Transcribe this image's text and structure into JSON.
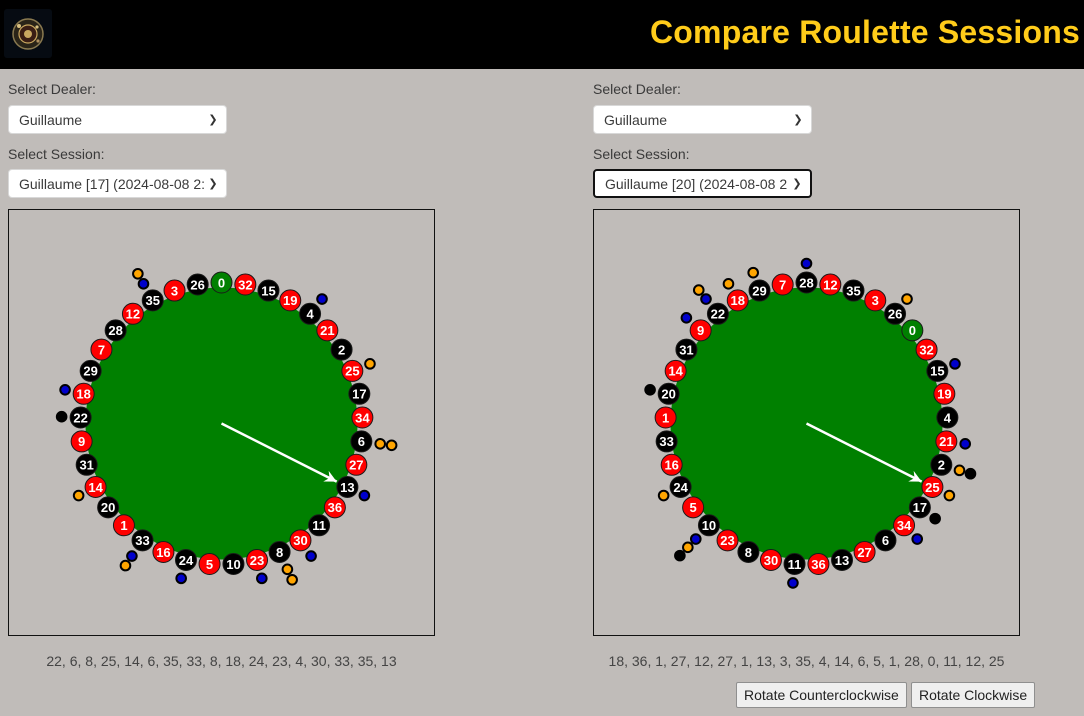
{
  "header": {
    "title": "Compare Roulette Sessions",
    "logo_icon": "roulette-wheel-logo"
  },
  "colors": {
    "header_bg": "#000000",
    "title": "#ffcc1a",
    "page_bg": "#c0bcb9",
    "felt": "#008000",
    "red": "#ff0000",
    "black": "#000000",
    "zero": "#008000",
    "dot_orange": "#ffa500",
    "dot_blue": "#0000cc",
    "dot_black": "#000000",
    "arrow": "#ffffff"
  },
  "wheel_order": [
    0,
    32,
    15,
    19,
    4,
    21,
    2,
    25,
    17,
    34,
    6,
    27,
    13,
    36,
    11,
    30,
    8,
    23,
    10,
    5,
    24,
    16,
    33,
    1,
    20,
    14,
    31,
    9,
    22,
    18,
    29,
    7,
    28,
    12,
    35,
    3,
    26
  ],
  "red_numbers": [
    1,
    3,
    5,
    7,
    9,
    12,
    14,
    16,
    18,
    19,
    21,
    23,
    25,
    27,
    30,
    32,
    34,
    36
  ],
  "panels": [
    {
      "dealer_label": "Select Dealer:",
      "dealer_value": "Guillaume",
      "session_label": "Select Session:",
      "session_value": "Guillaume [17] (2024-08-08 2:",
      "wheel": {
        "top_number": 0,
        "arrow_target": 13,
        "markers": [
          {
            "number": 35,
            "colors": [
              "blue",
              "orange"
            ]
          },
          {
            "number": 4,
            "colors": [
              "blue"
            ]
          },
          {
            "number": 25,
            "colors": [
              "orange"
            ]
          },
          {
            "number": 6,
            "colors": [
              "orange",
              "orange"
            ]
          },
          {
            "number": 13,
            "colors": [
              "blue"
            ]
          },
          {
            "number": 30,
            "colors": [
              "blue"
            ]
          },
          {
            "number": 8,
            "colors": [
              "orange",
              "orange"
            ]
          },
          {
            "number": 23,
            "colors": [
              "blue"
            ]
          },
          {
            "number": 24,
            "colors": [
              "blue"
            ]
          },
          {
            "number": 33,
            "colors": [
              "blue",
              "orange"
            ]
          },
          {
            "number": 14,
            "colors": [
              "orange"
            ]
          },
          {
            "number": 22,
            "colors": [
              "black"
            ]
          },
          {
            "number": 18,
            "colors": [
              "blue"
            ]
          }
        ]
      },
      "spins": [
        22,
        6,
        8,
        25,
        14,
        6,
        35,
        33,
        8,
        18,
        24,
        23,
        4,
        30,
        33,
        35,
        13
      ],
      "spins_text": "22, 6, 8, 25, 14, 6, 35, 33, 8, 18, 24, 23, 4, 30, 33, 35, 13"
    },
    {
      "dealer_label": "Select Dealer:",
      "dealer_value": "Guillaume",
      "session_label": "Select Session:",
      "session_value": "Guillaume [20] (2024-08-08 2:",
      "wheel": {
        "top_number": 28,
        "arrow_target": 25,
        "markers": [
          {
            "number": 28,
            "colors": [
              "blue"
            ]
          },
          {
            "number": 29,
            "colors": [
              "orange"
            ]
          },
          {
            "number": 18,
            "colors": [
              "orange"
            ]
          },
          {
            "number": 22,
            "colors": [
              "blue",
              "orange"
            ]
          },
          {
            "number": 9,
            "colors": [
              "blue"
            ]
          },
          {
            "number": 20,
            "colors": [
              "black"
            ]
          },
          {
            "number": 24,
            "colors": [
              "orange"
            ]
          },
          {
            "number": 10,
            "colors": [
              "blue",
              "orange",
              "black"
            ]
          },
          {
            "number": 11,
            "colors": [
              "blue"
            ]
          },
          {
            "number": 34,
            "colors": [
              "blue"
            ]
          },
          {
            "number": 17,
            "colors": [
              "black"
            ]
          },
          {
            "number": 25,
            "colors": [
              "orange"
            ]
          },
          {
            "number": 2,
            "colors": [
              "orange",
              "black"
            ]
          },
          {
            "number": 21,
            "colors": [
              "blue"
            ]
          },
          {
            "number": 15,
            "colors": [
              "blue"
            ]
          },
          {
            "number": 26,
            "colors": [
              "orange"
            ]
          }
        ]
      },
      "spins": [
        18,
        36,
        1,
        27,
        12,
        27,
        1,
        13,
        3,
        35,
        4,
        14,
        6,
        5,
        1,
        28,
        0,
        11,
        12,
        25
      ],
      "spins_text": "18, 36, 1, 27, 12, 27, 1, 13, 3, 35, 4, 14, 6, 5, 1, 28, 0, 11, 12, 25"
    }
  ],
  "controls": {
    "rotate_ccw_label": "Rotate Counterclockwise",
    "rotate_cw_label": "Rotate Clockwise"
  }
}
